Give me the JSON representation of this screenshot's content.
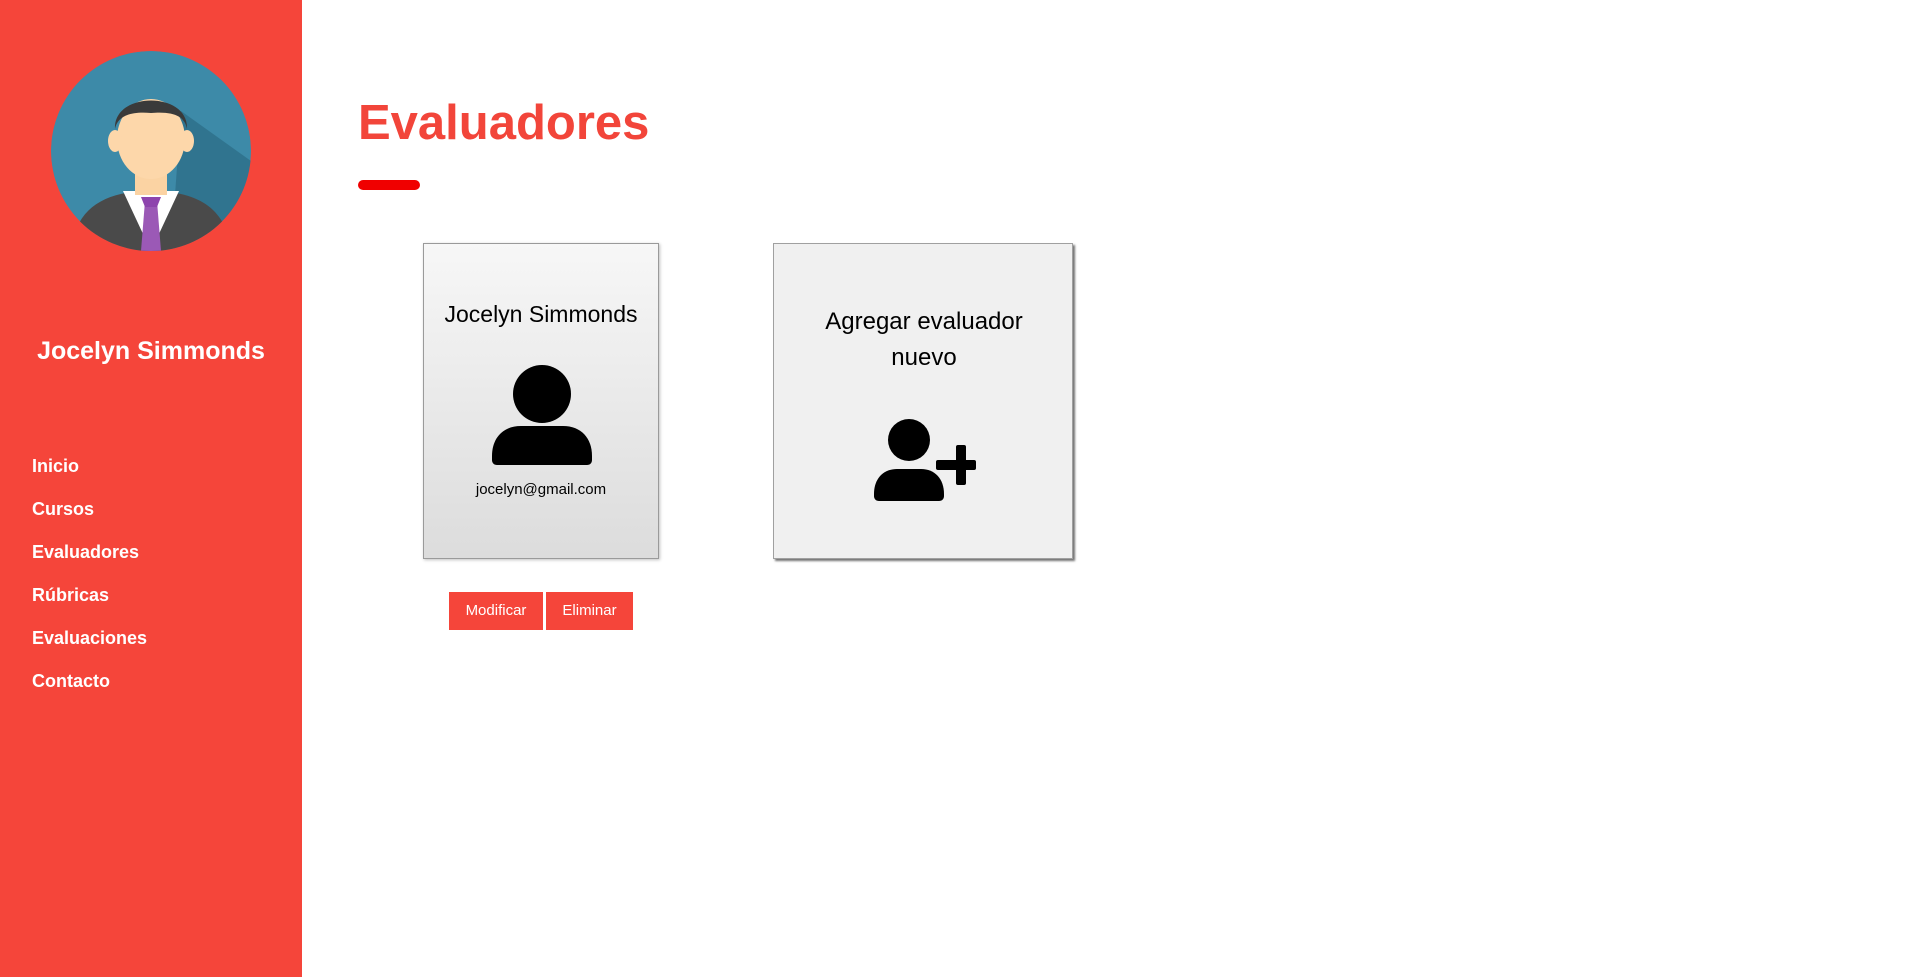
{
  "sidebar": {
    "user_name": "Jocelyn Simmonds",
    "avatar_icon": "businessman-avatar-icon",
    "nav_items": [
      {
        "label": "Inicio"
      },
      {
        "label": "Cursos"
      },
      {
        "label": "Evaluadores"
      },
      {
        "label": "Rúbricas"
      },
      {
        "label": "Evaluaciones"
      },
      {
        "label": "Contacto"
      }
    ]
  },
  "main": {
    "title": "Evaluadores",
    "evaluators": [
      {
        "name": "Jocelyn Simmonds",
        "email": "jocelyn@gmail.com",
        "icon": "person-icon",
        "modify_label": "Modificar",
        "delete_label": "Eliminar"
      }
    ],
    "add_card": {
      "label": "Agregar evaluador nuevo",
      "icon": "user-plus-icon"
    }
  },
  "colors": {
    "accent": "#f5453a",
    "title": "#f2453a",
    "underline": "#f00000"
  }
}
